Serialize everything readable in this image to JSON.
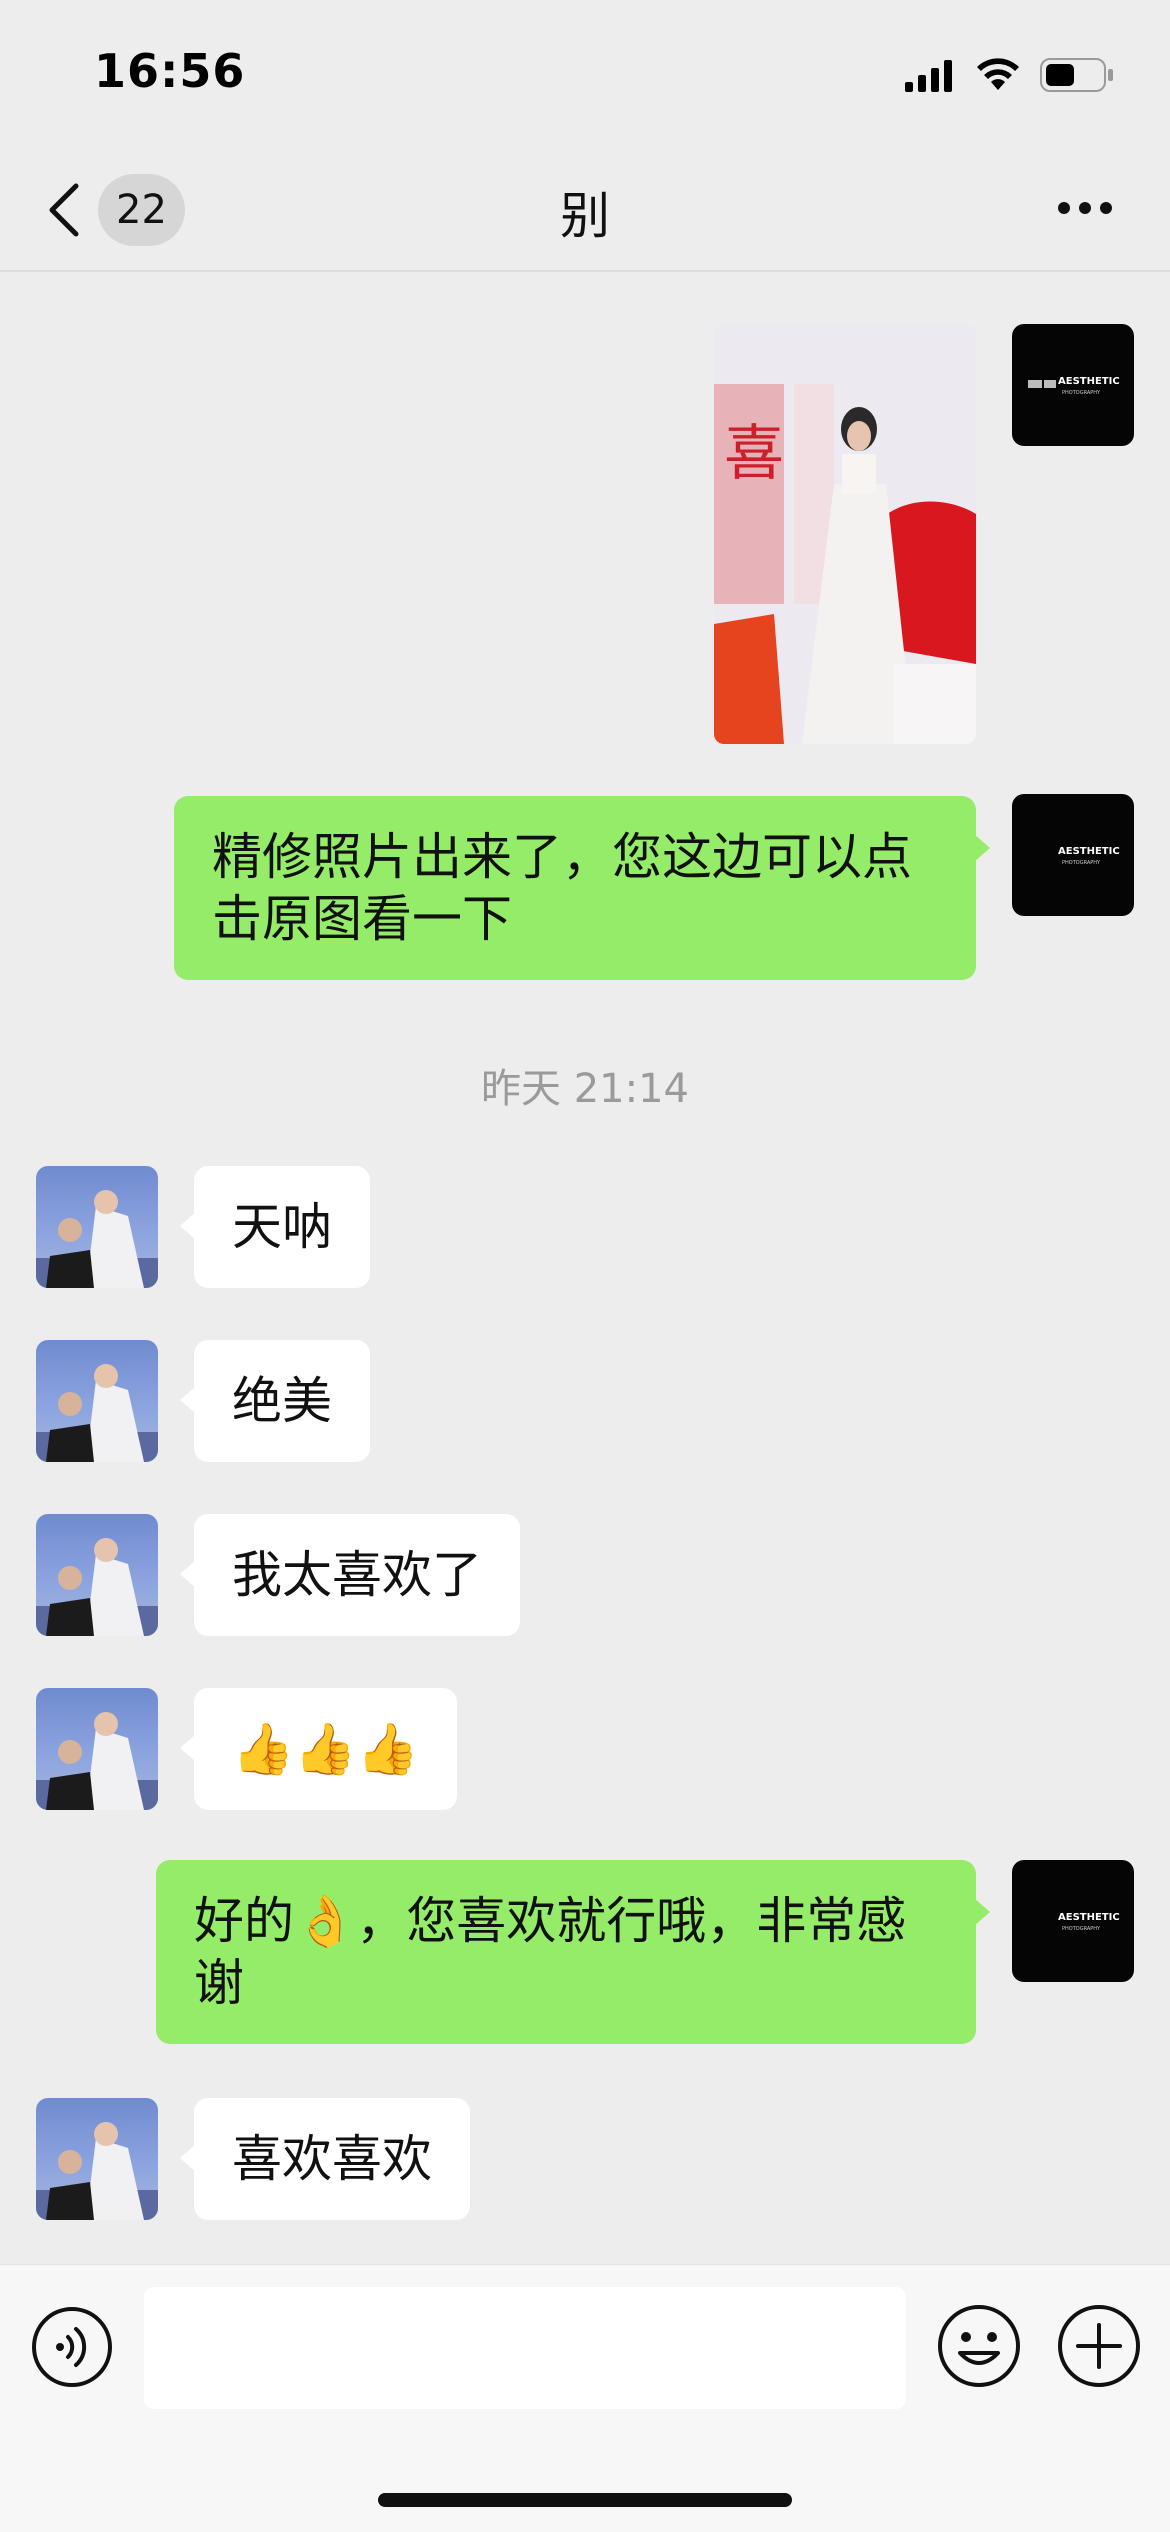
{
  "status_bar": {
    "time": "16:56"
  },
  "nav": {
    "unread_count": "22",
    "title": "别"
  },
  "messages": [
    {
      "from": "me",
      "type": "image"
    },
    {
      "from": "me",
      "type": "text",
      "text": "精修照片出来了，您这边可以点击原图看一下"
    },
    {
      "type": "timestamp",
      "text": "昨天 21:14"
    },
    {
      "from": "them",
      "type": "text",
      "text": "天呐"
    },
    {
      "from": "them",
      "type": "text",
      "text": "绝美"
    },
    {
      "from": "them",
      "type": "text",
      "text": "我太喜欢了"
    },
    {
      "from": "them",
      "type": "text",
      "text": "👍👍👍"
    },
    {
      "from": "me",
      "type": "text",
      "text": "好的👌，您喜欢就行哦，非常感谢"
    },
    {
      "from": "them",
      "type": "text",
      "text": "喜欢喜欢"
    }
  ],
  "studio_avatar": {
    "logo_text": "AESTHETIC",
    "sub_text": "PHOTOGRAPHY"
  },
  "input": {
    "value": "",
    "placeholder": ""
  },
  "icons": {
    "back": "chevron-left-icon",
    "more": "more-dots-icon",
    "voice": "voice-icon",
    "emoji": "emoji-icon",
    "plus": "plus-icon"
  },
  "colors": {
    "outgoing_bubble": "#95ec69",
    "incoming_bubble": "#ffffff",
    "background": "#ededed"
  }
}
